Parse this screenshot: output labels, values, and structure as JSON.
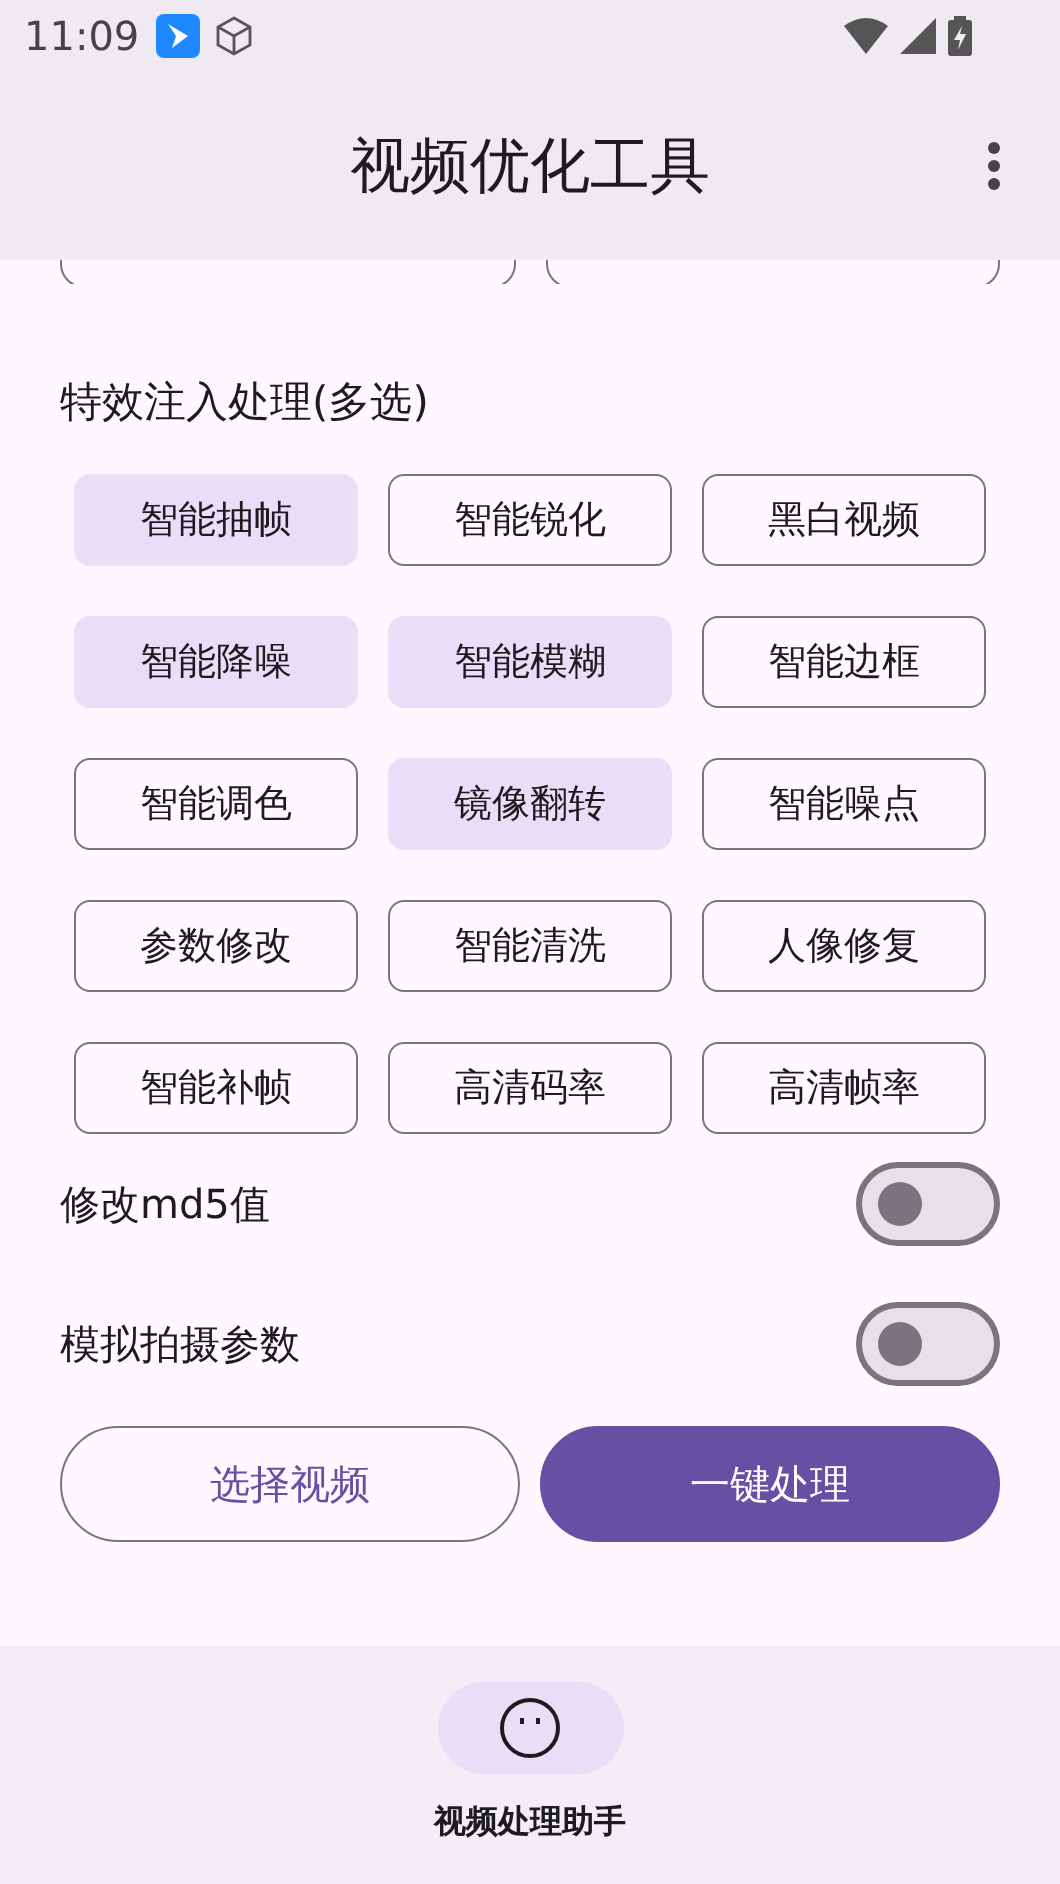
{
  "status_bar": {
    "time": "11:09"
  },
  "app_bar": {
    "title": "视频优化工具"
  },
  "effects": {
    "title": "特效注入处理(多选)",
    "chips": [
      {
        "label": "智能抽帧",
        "selected": true
      },
      {
        "label": "智能锐化",
        "selected": false
      },
      {
        "label": "黑白视频",
        "selected": false
      },
      {
        "label": "智能降噪",
        "selected": true
      },
      {
        "label": "智能模糊",
        "selected": true
      },
      {
        "label": "智能边框",
        "selected": false
      },
      {
        "label": "智能调色",
        "selected": false
      },
      {
        "label": "镜像翻转",
        "selected": true
      },
      {
        "label": "智能噪点",
        "selected": false
      },
      {
        "label": "参数修改",
        "selected": false
      },
      {
        "label": "智能清洗",
        "selected": false
      },
      {
        "label": "人像修复",
        "selected": false
      },
      {
        "label": "智能补帧",
        "selected": false
      },
      {
        "label": "高清码率",
        "selected": false
      },
      {
        "label": "高清帧率",
        "selected": false
      }
    ]
  },
  "switches": [
    {
      "label": "修改md5值",
      "on": false
    },
    {
      "label": "模拟拍摄参数",
      "on": false
    }
  ],
  "buttons": [
    {
      "label": "选择视频",
      "kind": "outlined"
    },
    {
      "label": "一键处理",
      "kind": "filled"
    }
  ],
  "bottom_nav": [
    {
      "label": "视频处理助手",
      "selected": true
    }
  ]
}
